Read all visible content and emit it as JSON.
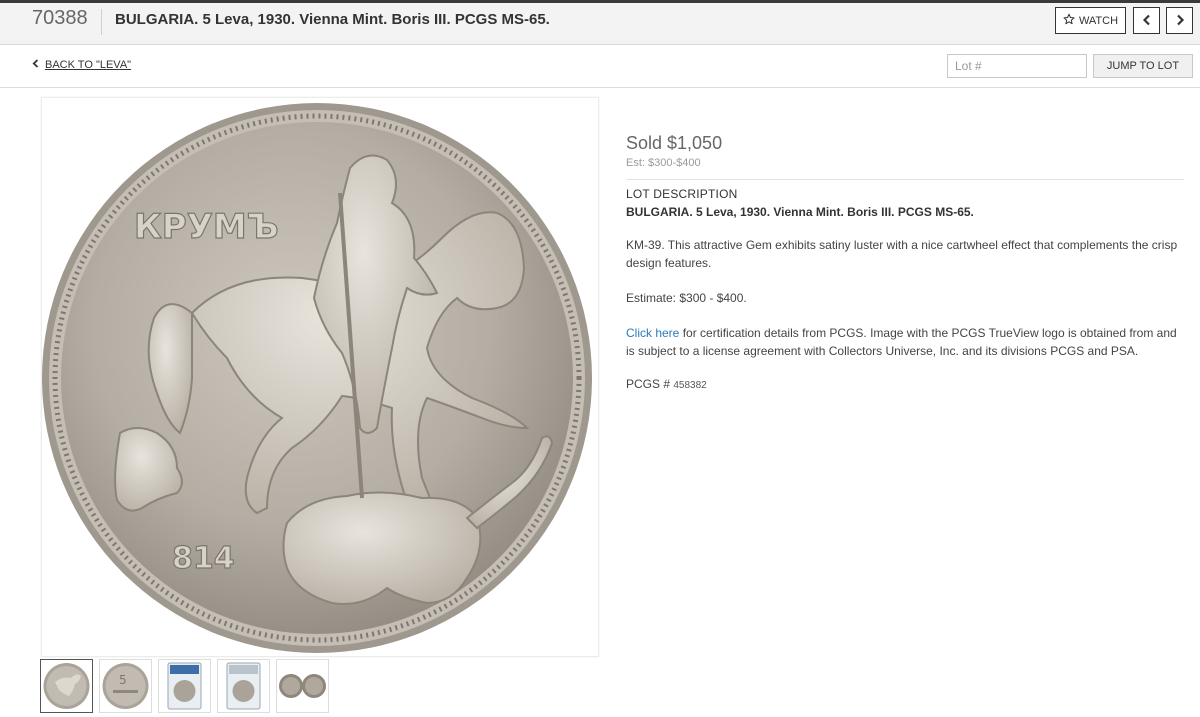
{
  "header": {
    "lot_number": "70388",
    "title": "BULGARIA. 5 Leva, 1930. Vienna Mint. Boris III. PCGS MS-65.",
    "watch_label": "WATCH",
    "prev_glyph": "‹",
    "next_glyph": "›"
  },
  "subnav": {
    "back_label": "BACK TO \"LEVA\"",
    "lot_placeholder": "Lot #",
    "jump_label": "JUMP TO LOT"
  },
  "coin": {
    "legend": "КРУМЪ",
    "number": "814"
  },
  "thumbnails": [
    {
      "name": "obverse-thumb",
      "selected": true
    },
    {
      "name": "reverse-thumb",
      "selected": false
    },
    {
      "name": "slab-front-thumb",
      "selected": false
    },
    {
      "name": "slab-back-thumb",
      "selected": false
    },
    {
      "name": "both-sides-thumb",
      "selected": false
    }
  ],
  "lot": {
    "sold": "Sold $1,050",
    "estimate": "Est: $300-$400",
    "description_heading": "LOT DESCRIPTION",
    "description_title": "BULGARIA. 5 Leva, 1930. Vienna Mint. Boris III. PCGS MS-65.",
    "description_body": "KM-39. This attractive Gem exhibits satiny luster with a nice cartwheel effect that complements the crisp design features.",
    "estimate_line": "Estimate: $300 - $400.",
    "cert_link": "Click here",
    "cert_text": " for certification details from PCGS. Image with the PCGS TrueView logo is obtained from and is subject to a license agreement with Collectors Universe, Inc. and its divisions PCGS and PSA.",
    "pcgs_label": "PCGS # ",
    "pcgs_number": "458382"
  },
  "colors": {
    "link": "#2a7bbf",
    "coin_metal": "#b3aca2"
  }
}
